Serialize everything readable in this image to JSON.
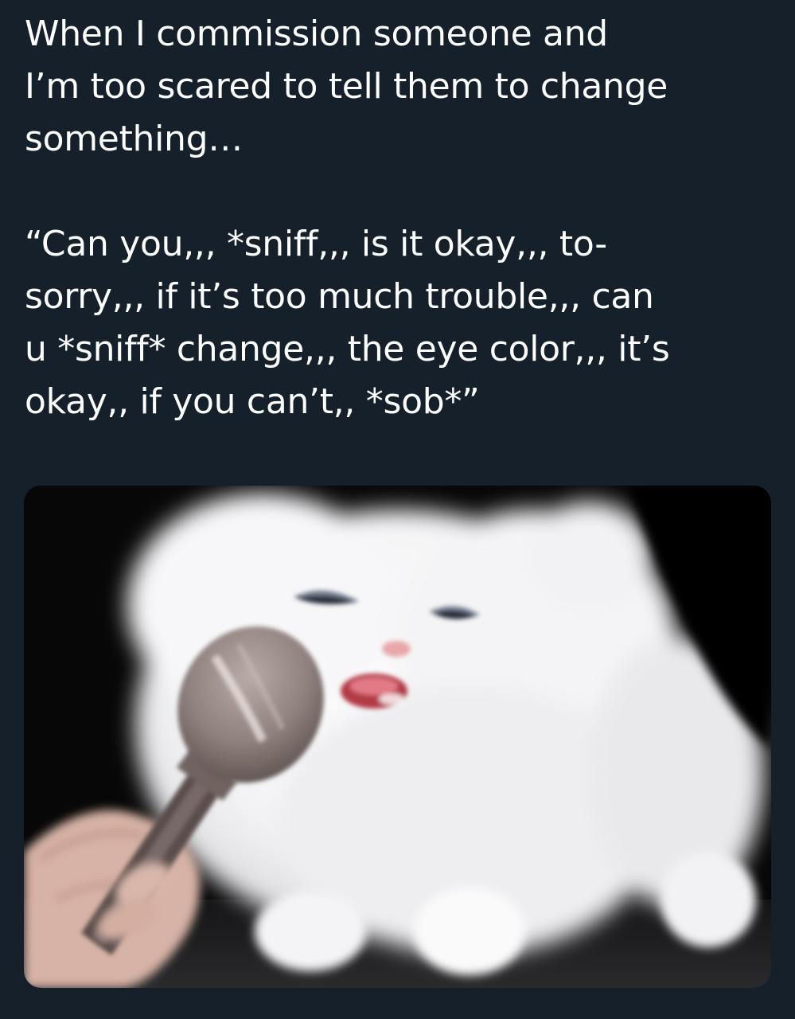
{
  "theme": {
    "background": "#15202b",
    "text": "#ffffff"
  },
  "tweet": {
    "setup": "When I commission someone and\nI’m too scared to tell them to change\nsomething…",
    "quote": "“Can you,,, *sniff,,, is it okay,,, to-\nsorry,,, if it’s too much trouble,,, can\nu *sniff* change,,, the eye color,,, it’s\nokay,, if you can’t,, *sob*”"
  },
  "media": {
    "subject": "crying-white-kitten-with-microphone"
  }
}
